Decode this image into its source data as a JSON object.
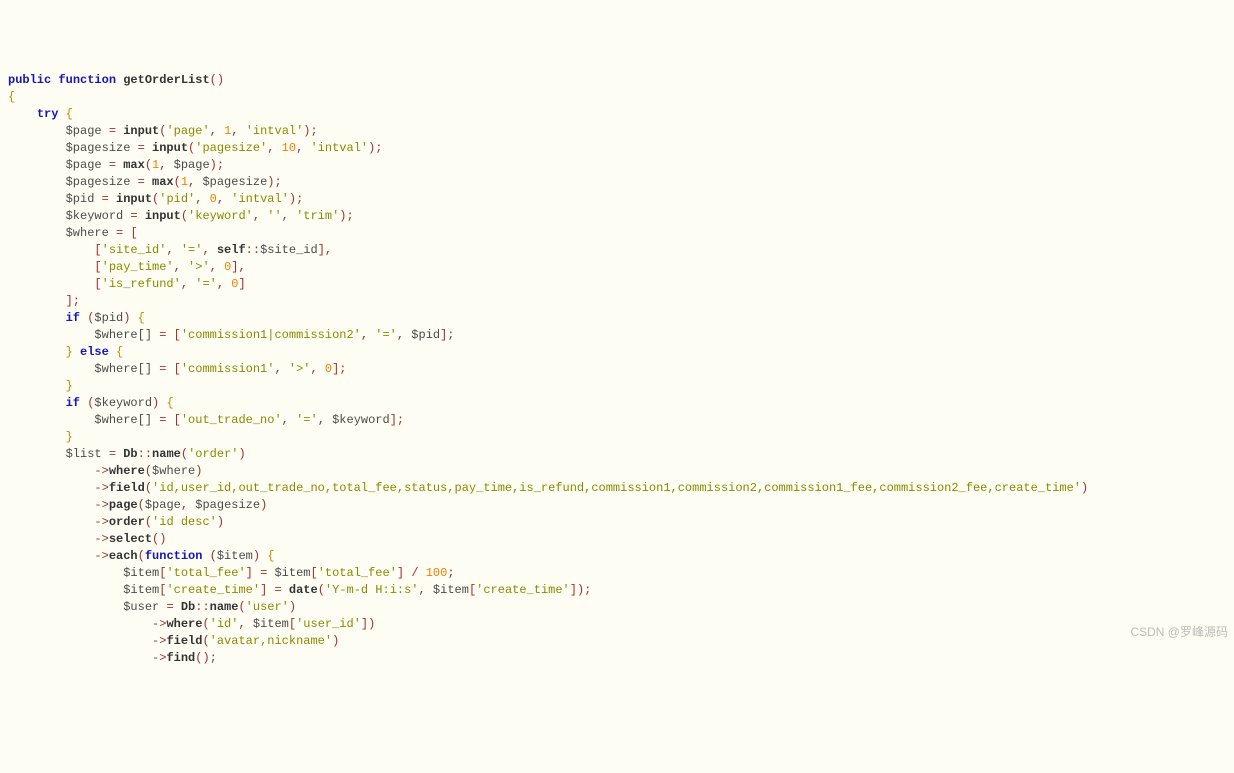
{
  "watermark": "CSDN @罗峰源码",
  "code": {
    "declaration": {
      "modifier": "public",
      "keyword": "function",
      "name": "getOrderList"
    },
    "kw": {
      "try": "try",
      "if": "if",
      "else": "else",
      "function": "function"
    },
    "fn": {
      "input": "input",
      "max": "max",
      "name": "name",
      "where": "where",
      "field": "field",
      "page": "page",
      "order": "order",
      "select": "select",
      "each": "each",
      "date": "date",
      "find": "find"
    },
    "scope": {
      "self": "self",
      "db": "Db"
    },
    "var": {
      "page": "$page",
      "pagesize": "$pagesize",
      "pid": "$pid",
      "keyword": "$keyword",
      "where": "$where",
      "wherearr": "$where[]",
      "list": "$list",
      "item": "$item",
      "user": "$user",
      "site_id": "$site_id"
    },
    "str": {
      "page": "'page'",
      "intval": "'intval'",
      "pagesize": "'pagesize'",
      "pid": "'pid'",
      "keyword": "'keyword'",
      "empty": "''",
      "trim": "'trim'",
      "site_id": "'site_id'",
      "eq": "'='",
      "pay_time": "'pay_time'",
      "gt": "'>'",
      "is_refund": "'is_refund'",
      "c1c2": "'commission1|commission2'",
      "c1": "'commission1'",
      "out_trade_no": "'out_trade_no'",
      "order": "'order'",
      "id_desc": "'id desc'",
      "field_main": "'id,user_id,out_trade_no,total_fee,status,pay_time,is_refund,commission1,commission2,commission1_fee,commission2_fee,create_time'",
      "total_fee": "'total_fee'",
      "create_time": "'create_time'",
      "datefmt": "'Y-m-d H:i:s'",
      "user": "'user'",
      "id": "'id'",
      "user_id": "'user_id'",
      "avatar_nick": "'avatar,nickname'"
    },
    "num": {
      "one": "1",
      "ten": "10",
      "zero": "0",
      "hundred": "100"
    }
  }
}
